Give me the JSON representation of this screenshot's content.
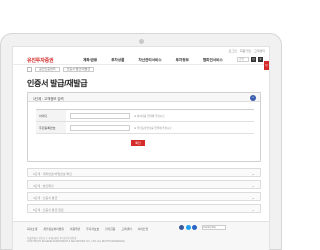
{
  "util": [
    "로그인",
    "회원가입",
    "고객센터"
  ],
  "header": {
    "logo": "유진투자증권",
    "nav": [
      "계좌/금융",
      "투자상품",
      "자산관리서비스",
      "투자정보",
      "챔피언서비스"
    ],
    "search_placeholder": "검색",
    "search_button": "Q",
    "menu_button": "≡"
  },
  "subnav": {
    "crumbs": [
      "공인인증센터",
      "인증서 발급/재발급"
    ]
  },
  "side_badge": "Q",
  "page": {
    "title": "인증서 발급/재발급"
  },
  "panel": {
    "title": "1단계 : 고객정보 입력",
    "chev": "^",
    "rows": [
      {
        "label": "아이디",
        "hint": "※ 아이디를 입력해 주십시오."
      },
      {
        "label": "주민등록번호",
        "hint": "※ 주민등록번호를 입력해 주십시오."
      }
    ],
    "submit": "확인"
  },
  "accordions": [
    "2단계 : 계좌번호/비밀번호 확인",
    "3단계 : 본인확인",
    "4단계 : 인증서 발급",
    "5단계 : 인증서 발급 완료"
  ],
  "footer": {
    "links": [
      "회사소개",
      "개인정보처리방침",
      "이용약관",
      "투자자보호",
      "전자금융",
      "고객센터",
      "사이트맵"
    ],
    "family_site": "Family Site",
    "address_lines": [
      "서울특별시 영등포구 국제금융로 24 유진투자증권",
      "COPYRIGHT EUGENE INVESTMENT & SECURITIES CO., LTD. ALL RIGHTS RESERVED."
    ]
  },
  "colors": {
    "brand": "#d42a2a",
    "accent": "#3a5dae"
  }
}
